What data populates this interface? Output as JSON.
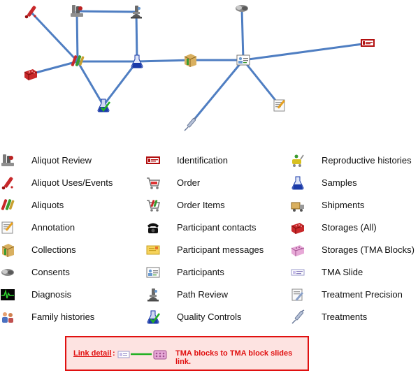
{
  "diagram": {
    "nodes": [
      {
        "id": "aliquot-uses",
        "icon": "aliquot-uses-icon"
      },
      {
        "id": "aliquot-review",
        "icon": "aliquot-review-icon"
      },
      {
        "id": "path-review",
        "icon": "path-review-icon"
      },
      {
        "id": "consents",
        "icon": "consents-icon"
      },
      {
        "id": "identification",
        "icon": "identification-icon"
      },
      {
        "id": "storages-all",
        "icon": "storages-all-icon"
      },
      {
        "id": "aliquots",
        "icon": "aliquots-icon"
      },
      {
        "id": "samples",
        "icon": "samples-icon"
      },
      {
        "id": "collections",
        "icon": "collections-icon"
      },
      {
        "id": "participants",
        "icon": "participants-icon"
      },
      {
        "id": "quality-controls",
        "icon": "quality-controls-icon"
      },
      {
        "id": "annotation",
        "icon": "annotation-icon"
      },
      {
        "id": "treatments",
        "icon": "treatments-icon"
      }
    ],
    "edges": [
      [
        "aliquot-uses",
        "aliquots"
      ],
      [
        "aliquot-review",
        "aliquots"
      ],
      [
        "aliquot-review",
        "path-review"
      ],
      [
        "path-review",
        "samples"
      ],
      [
        "storages-all",
        "aliquots"
      ],
      [
        "aliquots",
        "samples"
      ],
      [
        "aliquots",
        "quality-controls"
      ],
      [
        "samples",
        "quality-controls"
      ],
      [
        "samples",
        "collections"
      ],
      [
        "collections",
        "participants"
      ],
      [
        "consents",
        "participants"
      ],
      [
        "participants",
        "identification"
      ],
      [
        "participants",
        "annotation"
      ],
      [
        "participants",
        "treatments"
      ]
    ],
    "edge_color": "#4f7ec2"
  },
  "legend": {
    "col1": [
      {
        "icon": "aliquot-review-icon",
        "label": "Aliquot Review"
      },
      {
        "icon": "aliquot-uses-icon",
        "label": "Aliquot Uses/Events"
      },
      {
        "icon": "aliquots-icon",
        "label": "Aliquots"
      },
      {
        "icon": "annotation-icon",
        "label": "Annotation"
      },
      {
        "icon": "collections-icon",
        "label": "Collections"
      },
      {
        "icon": "consents-icon",
        "label": "Consents"
      },
      {
        "icon": "diagnosis-icon",
        "label": "Diagnosis"
      },
      {
        "icon": "family-histories-icon",
        "label": "Family histories"
      }
    ],
    "col2": [
      {
        "icon": "identification-icon",
        "label": "Identification"
      },
      {
        "icon": "order-icon",
        "label": "Order"
      },
      {
        "icon": "order-items-icon",
        "label": "Order Items"
      },
      {
        "icon": "participant-contacts-icon",
        "label": "Participant contacts"
      },
      {
        "icon": "participant-messages-icon",
        "label": "Participant messages"
      },
      {
        "icon": "participants-icon",
        "label": "Participants"
      },
      {
        "icon": "path-review-icon",
        "label": "Path Review"
      },
      {
        "icon": "quality-controls-icon",
        "label": "Quality Controls"
      }
    ],
    "col3": [
      {
        "icon": "reproductive-histories-icon",
        "label": "Reproductive histories"
      },
      {
        "icon": "samples-icon",
        "label": "Samples"
      },
      {
        "icon": "shipments-icon",
        "label": "Shipments"
      },
      {
        "icon": "storages-all-icon",
        "label": "Storages (All)"
      },
      {
        "icon": "storages-tma-icon",
        "label": "Storages (TMA Blocks)"
      },
      {
        "icon": "tma-slide-icon",
        "label": "TMA Slide"
      },
      {
        "icon": "treatment-precision-icon",
        "label": "Treatment Precision"
      },
      {
        "icon": "treatments-icon",
        "label": "Treatments"
      }
    ]
  },
  "link_detail": {
    "label": "Link detail",
    "colon": ":",
    "text": "TMA blocks to TMA block slides link.",
    "line_color": "#22b022",
    "border_color": "#e01010"
  }
}
